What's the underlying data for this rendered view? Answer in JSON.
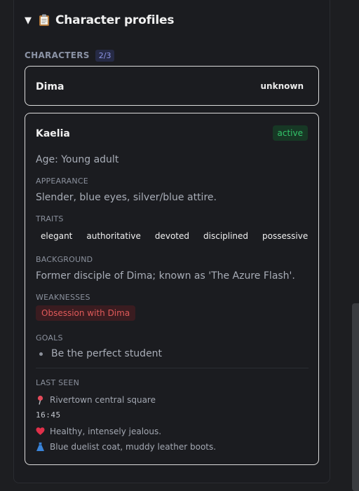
{
  "section": {
    "title": "Character profiles",
    "caret": "▼",
    "icon": "clipboard-icon"
  },
  "characters": {
    "label": "CHARACTERS",
    "count": "2/3"
  },
  "cards": [
    {
      "name": "Dima",
      "status": "unknown"
    },
    {
      "name": "Kaelia",
      "status": "active",
      "age": "Age: Young adult",
      "appearance_label": "APPEARANCE",
      "appearance": "Slender, blue eyes, silver/blue attire.",
      "traits_label": "TRAITS",
      "traits": [
        "elegant",
        "authoritative",
        "devoted",
        "disciplined",
        "possessive"
      ],
      "background_label": "BACKGROUND",
      "background": "Former disciple of Dima; known as 'The Azure Flash'.",
      "weaknesses_label": "WEAKNESSES",
      "weakness": "Obsession with Dima",
      "goals_label": "GOALS",
      "goal": "Be the perfect student",
      "last_seen_label": "LAST SEEN",
      "location": "Rivertown central square",
      "time": "16:45",
      "condition": "Healthy, intensely jealous.",
      "clothing": "Blue duelist coat, muddy leather boots."
    }
  ],
  "colors": {
    "active": "#33c46a",
    "weakness": "#e05a5a",
    "badge": "#8e96e8"
  }
}
